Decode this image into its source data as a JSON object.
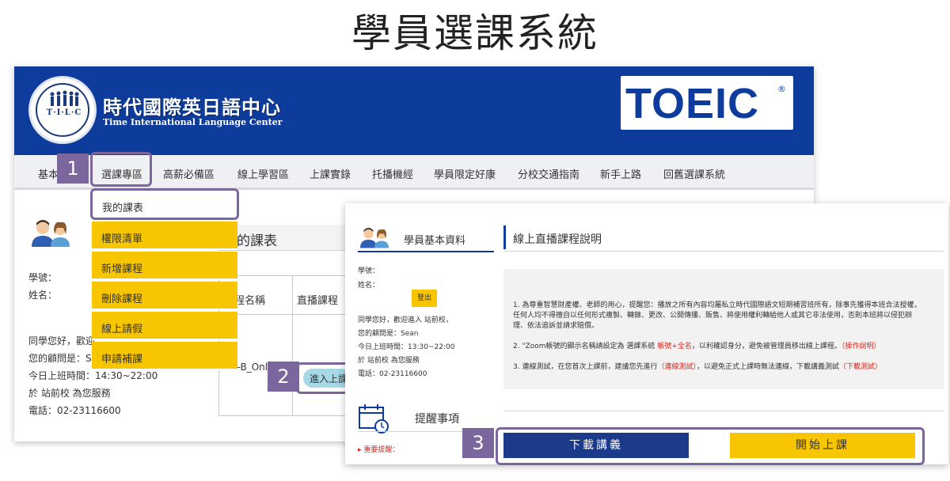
{
  "page_title": "學員選課系統",
  "header": {
    "logo_letters": "T·I·L·C",
    "brand_name_zh": "時代國際英日語中心",
    "brand_name_en": "Time International Language Center",
    "toeic_logo_text": "TOEIC",
    "toeic_registered": "®"
  },
  "nav": {
    "items": [
      "基本",
      "選課專區",
      "高薪必備區",
      "線上學習區",
      "上課實錄",
      "托播機經",
      "學員限定好康",
      "分校交通指南",
      "新手上路",
      "回舊選課系統"
    ]
  },
  "dropdown": {
    "items": [
      "我的課表",
      "權限清單",
      "新增課程",
      "刪除課程",
      "線上請假",
      "申請補課"
    ]
  },
  "left_panel": {
    "student_id_label": "學號：",
    "student_name_label": "姓名：",
    "greeting": "同學您好，歡迎",
    "advisor": "您的顧問是：S",
    "work_hours": "今日上班時間：14:30~22:00",
    "branch": "於 站前校 為您服務",
    "phone": "電話：02-23116600",
    "schedule_title": "我的課表",
    "table_col_name": "課程名稱",
    "table_col_live": "直播課程",
    "course_name": "VC-B_Onl",
    "enter_button": "進入上課"
  },
  "right_panel": {
    "student_info_title": "學員基本資料",
    "student_id_label": "學號：",
    "student_name_label": "姓名：",
    "logout_button": "登出",
    "greeting": "同學您好，歡迎進入 站前校，",
    "advisor": "您的顧問是：Sean",
    "work_hours": "今日上班時間：13:30~22:00",
    "branch": "於 站前校 為您服務",
    "phone": "電話：02-23116600",
    "reminder_title": "提醒事項",
    "important_reminder": "▸ 重要提醒：",
    "section_title": "線上直播課程說明",
    "notice": {
      "line1": "1. 為尊重智慧財產權、老師的用心，提醒您：播放之所有內容均屬私立時代國際語文短期補習班所有，除事先獲得本班合法授權，",
      "line1b": "任何人均不得擅自以任何形式複製、轉錄、更改、公開傳播、販售、將使用權利轉給他人或其它非法使用，否則本班將以侵犯辦",
      "line1c": "理、依法追訴並請求賠償。",
      "line2_a": "2. \"Zoom帳號的顯示名稱請設定為 選課系統",
      "line2_red": "帳號+全名",
      "line2_b": "，以利確認身分，避免被管理員移出線上課程。",
      "line2_link": "（操作說明）",
      "line3_a": "3. 連線測試，在您首次上課前，建議您先進行",
      "line3_link1": "（連線測試）",
      "line3_b": "，以避免正式上課時無法連線，下載講義測試",
      "line3_link2": "（下載測試）"
    },
    "download_button": "下載講義",
    "start_button": "開始上課"
  },
  "callouts": [
    "1",
    "2",
    "3"
  ],
  "colors": {
    "brand_blue": "#0d3c9c",
    "menu_yellow": "#f7c600",
    "highlight_purple": "#7c669e",
    "notice_red": "#d9261c",
    "button_navy": "#1c3a8a"
  }
}
